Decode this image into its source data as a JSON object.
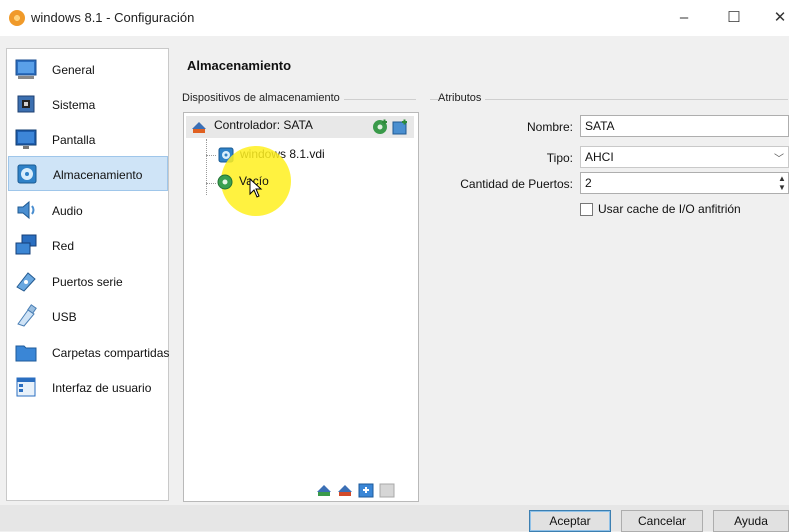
{
  "window": {
    "title": "windows 8.1 - Configuración",
    "controls": {
      "minimize": "–",
      "maximize": "☐",
      "close": "✕"
    }
  },
  "sidebar": {
    "items": [
      {
        "label": "General",
        "icon": "general-icon"
      },
      {
        "label": "Sistema",
        "icon": "system-icon"
      },
      {
        "label": "Pantalla",
        "icon": "display-icon"
      },
      {
        "label": "Almacenamiento",
        "icon": "storage-icon",
        "selected": true
      },
      {
        "label": "Audio",
        "icon": "audio-icon"
      },
      {
        "label": "Red",
        "icon": "network-icon"
      },
      {
        "label": "Puertos serie",
        "icon": "serial-ports-icon"
      },
      {
        "label": "USB",
        "icon": "usb-icon"
      },
      {
        "label": "Carpetas compartidas",
        "icon": "shared-folders-icon"
      },
      {
        "label": "Interfaz de usuario",
        "icon": "user-interface-icon"
      }
    ]
  },
  "main": {
    "title": "Almacenamiento",
    "devices_group": "Dispositivos de almacenamiento",
    "tree": {
      "controller": "Controlador: SATA",
      "disk": "windows 8.1.vdi",
      "optical": "Vacío"
    },
    "attributes_group": "Atributos",
    "attributes": {
      "name_label": "Nombre:",
      "name_value": "SATA",
      "type_label": "Tipo:",
      "type_value": "AHCI",
      "ports_label": "Cantidad de Puertos:",
      "ports_value": "2",
      "cache_label": "Usar cache de I/O anfitrión",
      "cache_checked": false
    }
  },
  "footer": {
    "accept": "Aceptar",
    "cancel": "Cancelar",
    "help": "Ayuda"
  },
  "colors": {
    "selection": "#cfe4f7",
    "accent": "#3c7fb1",
    "highlight": "#fff01e"
  }
}
